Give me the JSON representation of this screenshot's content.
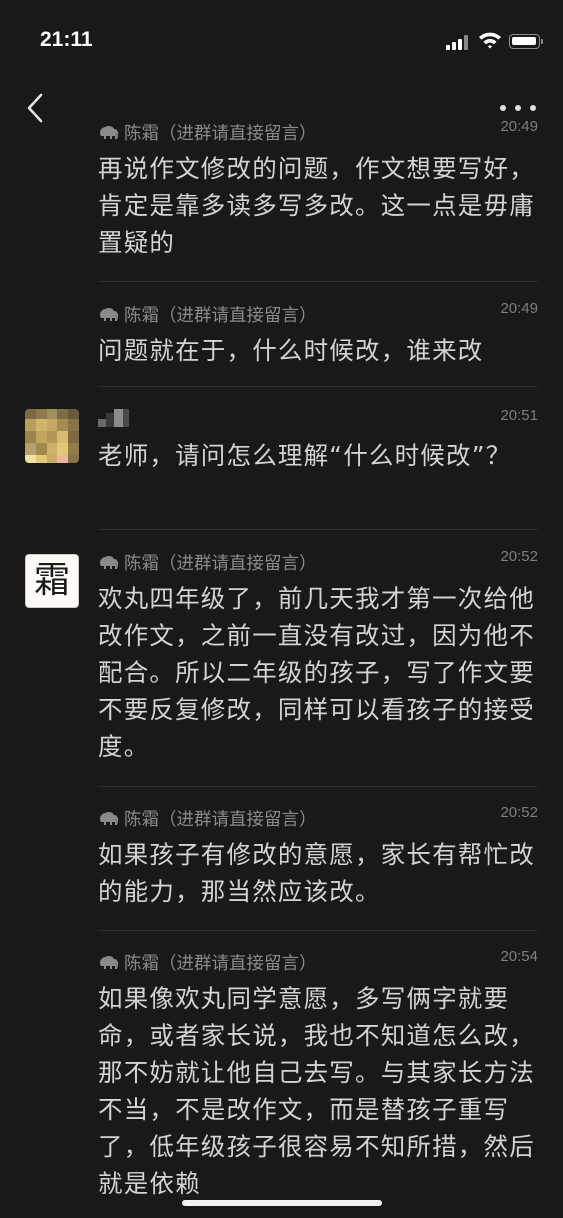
{
  "status_bar": {
    "time": "21:11"
  },
  "messages": [
    {
      "sender": "陈霜（进群请直接留言）",
      "time": "20:49",
      "text": "再说作文修改的问题，作文想要写好，肯定是靠多读多写多改。这一点是毋庸置疑的"
    },
    {
      "sender": "陈霜（进群请直接留言）",
      "time": "20:49",
      "text": "问题就在于，什么时候改，谁来改"
    },
    {
      "sender": "",
      "time": "20:51",
      "text": "老师，请问怎么理解“什么时候改”？"
    },
    {
      "sender": "陈霜（进群请直接留言）",
      "time": "20:52",
      "text": "欢丸四年级了，前几天我才第一次给他改作文，之前一直没有改过，因为他不配合。所以二年级的孩子，写了作文要不要反复修改，同样可以看孩子的接受度。"
    },
    {
      "sender": "陈霜（进群请直接留言）",
      "time": "20:52",
      "text": "如果孩子有修改的意愿，家长有帮忙改的能力，那当然应该改。"
    },
    {
      "sender": "陈霜（进群请直接留言）",
      "time": "20:54",
      "text": "如果像欢丸同学意愿，多写俩字就要命，或者家长说，我也不知道怎么改，那不妨就让他自己去写。与其家长方法不当，不是改作文，而是替孩子重写了，低年级孩子很容易不知所措，然后就是依赖"
    }
  ],
  "avatar_char": "霜",
  "icons": {
    "back": "chevron-left-icon",
    "more": "more-dots-icon",
    "sender": "elephant-icon"
  },
  "colors": {
    "background": "#191919",
    "text": "#d3d3d3",
    "meta": "#8b8b8b"
  }
}
